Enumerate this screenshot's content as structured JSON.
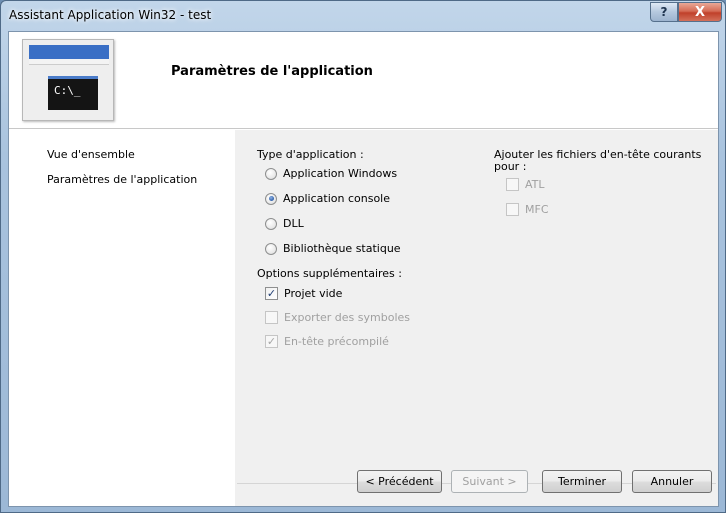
{
  "window": {
    "title": "Assistant Application Win32 - test",
    "help_symbol": "?",
    "close_symbol": "X"
  },
  "header": {
    "title": "Paramètres de l'application",
    "thumbnail_prompt": "C:\\_"
  },
  "nav": {
    "items": [
      {
        "label": "Vue d'ensemble"
      },
      {
        "label": "Paramètres de l'application"
      }
    ]
  },
  "app_type": {
    "label": "Type d'application :",
    "options": [
      {
        "label": "Application Windows",
        "selected": false
      },
      {
        "label": "Application console",
        "selected": true
      },
      {
        "label": "DLL",
        "selected": false
      },
      {
        "label": "Bibliothèque statique",
        "selected": false
      }
    ]
  },
  "extra_options": {
    "label": "Options supplémentaires :",
    "items": [
      {
        "label": "Projet vide",
        "checked": true,
        "enabled": true
      },
      {
        "label": "Exporter des symboles",
        "checked": false,
        "enabled": false
      },
      {
        "label": "En-tête précompilé",
        "checked": true,
        "enabled": false
      }
    ]
  },
  "common_headers": {
    "label_line1": "Ajouter les fichiers d'en-tête courants",
    "label_line2": "pour :",
    "items": [
      {
        "label": "ATL",
        "checked": false,
        "enabled": false
      },
      {
        "label": "MFC",
        "checked": false,
        "enabled": false
      }
    ]
  },
  "buttons": {
    "previous": "< Précédent",
    "next": "Suivant >",
    "finish": "Terminer",
    "cancel": "Annuler"
  },
  "check_mark": "✓"
}
